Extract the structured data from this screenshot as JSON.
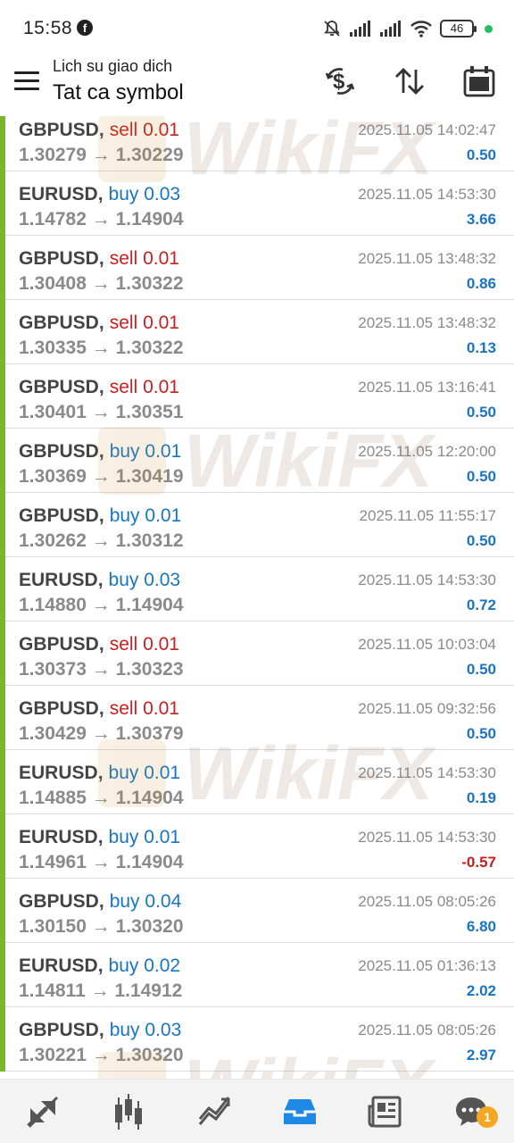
{
  "status_bar": {
    "time": "15:58",
    "battery": "46"
  },
  "header": {
    "subtitle": "Lich su giao dich",
    "title": "Tat ca symbol",
    "icons": [
      "menu-icon",
      "dollar-exchange-icon",
      "sort-arrows-icon",
      "calendar-icon"
    ]
  },
  "watermark": "WikiFX",
  "trades": [
    {
      "symbol": "GBPUSD",
      "action": "sell",
      "volume": "0.01",
      "open": "1.30279",
      "close": "1.30229",
      "time": "2025.11.05 14:02:47",
      "profit": "0.50"
    },
    {
      "symbol": "EURUSD",
      "action": "buy",
      "volume": "0.03",
      "open": "1.14782",
      "close": "1.14904",
      "time": "2025.11.05 14:53:30",
      "profit": "3.66"
    },
    {
      "symbol": "GBPUSD",
      "action": "sell",
      "volume": "0.01",
      "open": "1.30408",
      "close": "1.30322",
      "time": "2025.11.05 13:48:32",
      "profit": "0.86"
    },
    {
      "symbol": "GBPUSD",
      "action": "sell",
      "volume": "0.01",
      "open": "1.30335",
      "close": "1.30322",
      "time": "2025.11.05 13:48:32",
      "profit": "0.13"
    },
    {
      "symbol": "GBPUSD",
      "action": "sell",
      "volume": "0.01",
      "open": "1.30401",
      "close": "1.30351",
      "time": "2025.11.05 13:16:41",
      "profit": "0.50"
    },
    {
      "symbol": "GBPUSD",
      "action": "buy",
      "volume": "0.01",
      "open": "1.30369",
      "close": "1.30419",
      "time": "2025.11.05 12:20:00",
      "profit": "0.50"
    },
    {
      "symbol": "GBPUSD",
      "action": "buy",
      "volume": "0.01",
      "open": "1.30262",
      "close": "1.30312",
      "time": "2025.11.05 11:55:17",
      "profit": "0.50"
    },
    {
      "symbol": "EURUSD",
      "action": "buy",
      "volume": "0.03",
      "open": "1.14880",
      "close": "1.14904",
      "time": "2025.11.05 14:53:30",
      "profit": "0.72"
    },
    {
      "symbol": "GBPUSD",
      "action": "sell",
      "volume": "0.01",
      "open": "1.30373",
      "close": "1.30323",
      "time": "2025.11.05 10:03:04",
      "profit": "0.50"
    },
    {
      "symbol": "GBPUSD",
      "action": "sell",
      "volume": "0.01",
      "open": "1.30429",
      "close": "1.30379",
      "time": "2025.11.05 09:32:56",
      "profit": "0.50"
    },
    {
      "symbol": "EURUSD",
      "action": "buy",
      "volume": "0.01",
      "open": "1.14885",
      "close": "1.14904",
      "time": "2025.11.05 14:53:30",
      "profit": "0.19"
    },
    {
      "symbol": "EURUSD",
      "action": "buy",
      "volume": "0.01",
      "open": "1.14961",
      "close": "1.14904",
      "time": "2025.11.05 14:53:30",
      "profit": "-0.57"
    },
    {
      "symbol": "GBPUSD",
      "action": "buy",
      "volume": "0.04",
      "open": "1.30150",
      "close": "1.30320",
      "time": "2025.11.05 08:05:26",
      "profit": "6.80"
    },
    {
      "symbol": "EURUSD",
      "action": "buy",
      "volume": "0.02",
      "open": "1.14811",
      "close": "1.14912",
      "time": "2025.11.05 01:36:13",
      "profit": "2.02"
    },
    {
      "symbol": "GBPUSD",
      "action": "buy",
      "volume": "0.03",
      "open": "1.30221",
      "close": "1.30320",
      "time": "2025.11.05 08:05:26",
      "profit": "2.97"
    }
  ],
  "bottom_nav": {
    "items": [
      "quotes-icon",
      "chart-icon",
      "trade-icon",
      "history-icon",
      "news-icon",
      "messages-icon"
    ],
    "active": "history-icon",
    "messages_badge": "1"
  },
  "colors": {
    "buy": "#1874c4",
    "sell": "#c81e1e",
    "row_bar": "#76b82a",
    "active_nav": "#1e88e5"
  }
}
